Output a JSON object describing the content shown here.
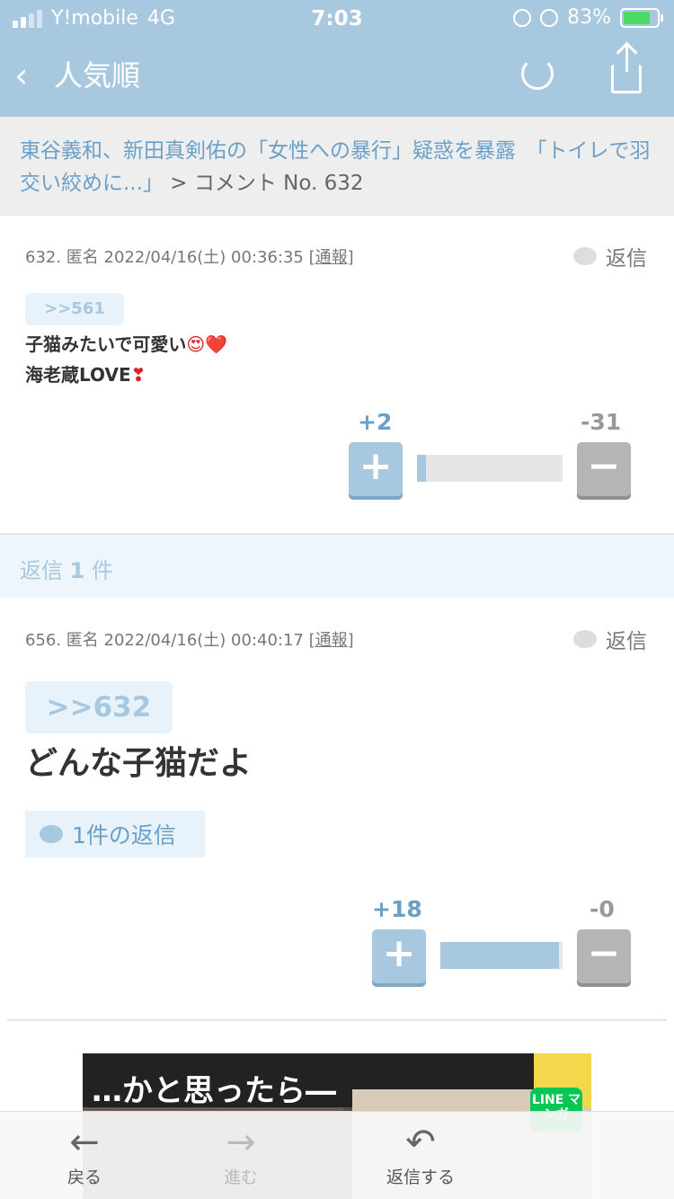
{
  "status_bar": {
    "carrier": "Y!mobile",
    "network": "4G",
    "time": "7:03",
    "battery": "83%"
  },
  "nav": {
    "title": "人気順"
  },
  "breadcrumb": {
    "article": "東谷義和、新田真剣佑の「女性への暴行」疑惑を暴露　「トイレで羽交い絞めに...」",
    "separator": ">",
    "current": "コメント No. 632"
  },
  "comments": [
    {
      "meta": "632. 匿名 2022/04/16(土) 00:36:35",
      "report": "[通報]",
      "reply_label": "返信",
      "anchor": ">>561",
      "lines": [
        "子猫みたいで可愛い",
        "海老蔵LOVE"
      ],
      "emoji_line1": "😍❤️",
      "emoji_line2": "❣",
      "plus_score": "+2",
      "minus_score": "-31",
      "plus_ratio": 0.06
    },
    {
      "meta": "656. 匿名 2022/04/16(土) 00:40:17",
      "report": "[通報]",
      "reply_label": "返信",
      "anchor": ">>632",
      "lines": [
        "どんな子猫だよ"
      ],
      "reply_count_label": "1件の返信",
      "plus_score": "+18",
      "minus_score": "-0",
      "plus_ratio": 0.97
    }
  ],
  "replies_header": {
    "prefix": "返信",
    "count": "1",
    "suffix": "件"
  },
  "vote_buttons": {
    "plus": "+",
    "minus": "−"
  },
  "ad": {
    "headline": "…かと思ったら―",
    "badge": "LINE マンガ"
  },
  "toolbar": {
    "back": "戻る",
    "forward": "進む",
    "reply": "返信する"
  }
}
